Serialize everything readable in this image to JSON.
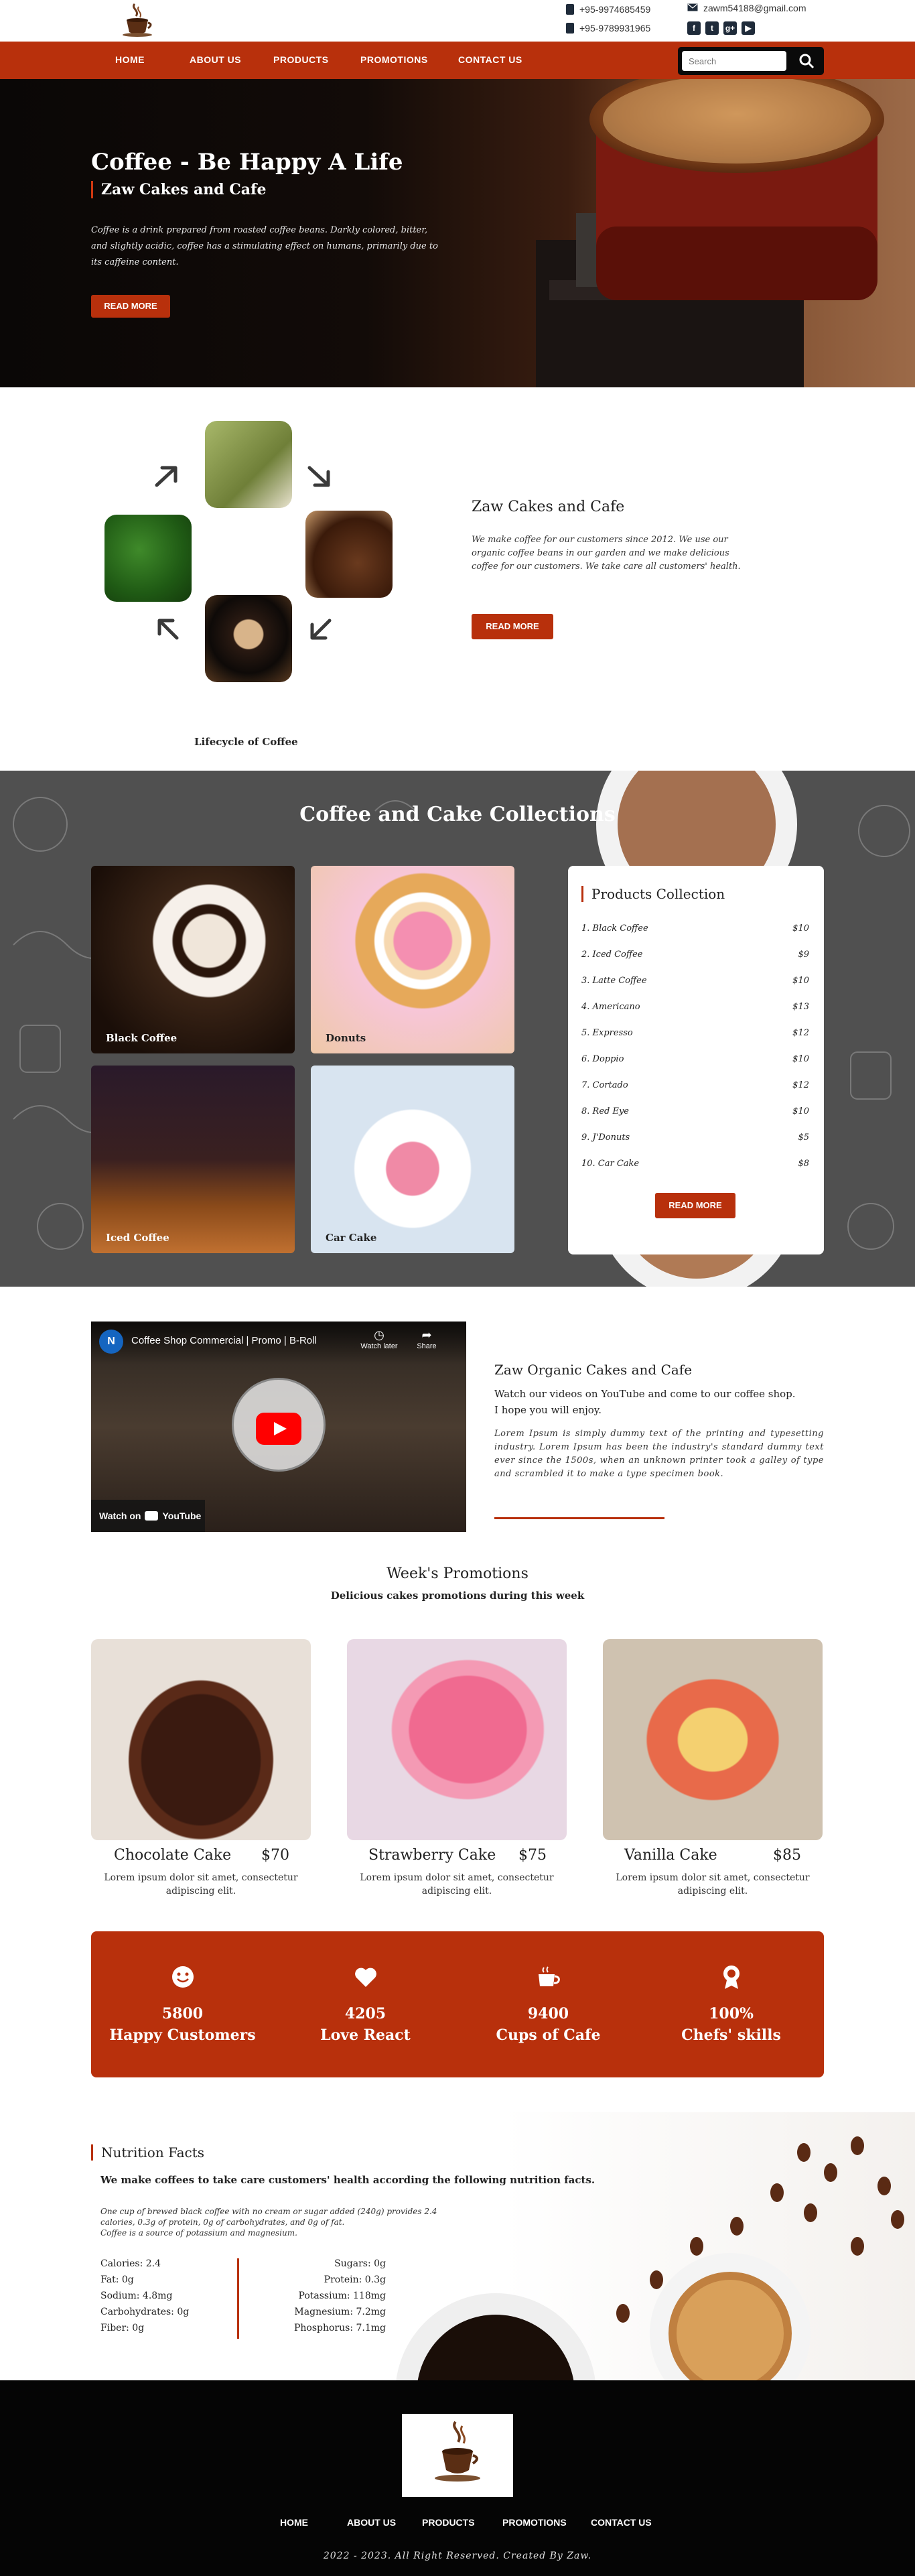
{
  "header": {
    "logo_alt": "Zaw Cakes and Cafe logo",
    "phone_1": "+95-9974685459",
    "phone_2": "+95-9789931965",
    "email": "zawm54188@gmail.com",
    "social": [
      "facebook-icon",
      "twitter-icon",
      "google-plus-icon",
      "youtube-icon"
    ]
  },
  "nav": {
    "items": [
      "HOME",
      "ABOUT US",
      "PRODUCTS",
      "PROMOTIONS",
      "CONTACT US"
    ],
    "search_placeholder": "Search"
  },
  "hero": {
    "title": "Coffee - Be Happy A Life",
    "subtitle": "Zaw Cakes and Cafe",
    "body": "Coffee is a drink prepared from roasted coffee beans. Darkly colored, bitter, and slightly acidic, coffee has a stimulating effect on humans, primarily due to its caffeine content.",
    "button": "READ MORE"
  },
  "about": {
    "title": "Zaw Cakes and Cafe",
    "body": "We make coffee for our customers since 2012. We use our organic coffee beans in our garden and we make delicious coffee for our customers. We take care all customers' health.",
    "button": "READ MORE",
    "lifecycle_caption": "Lifecycle of Coffee"
  },
  "collections": {
    "title": "Coffee and Cake Collections",
    "tiles": [
      "Black Coffee",
      "Donuts",
      "Iced Coffee",
      "Car Cake"
    ],
    "products_title": "Products Collection",
    "products": [
      {
        "name": "1. Black Coffee",
        "price": "$10"
      },
      {
        "name": "2. Iced Coffee",
        "price": "$9"
      },
      {
        "name": "3. Latte Coffee",
        "price": "$10"
      },
      {
        "name": "4. Americano",
        "price": "$13"
      },
      {
        "name": "5. Expresso",
        "price": "$12"
      },
      {
        "name": "6. Doppio",
        "price": "$10"
      },
      {
        "name": "7. Cortado",
        "price": "$12"
      },
      {
        "name": "8. Red Eye",
        "price": "$10"
      },
      {
        "name": "9. J'Donuts",
        "price": "$5"
      },
      {
        "name": "10. Car Cake",
        "price": "$8"
      }
    ],
    "button": "READ MORE"
  },
  "video": {
    "channel_letter": "N",
    "title": "Coffee Shop Commercial | Promo | B-Roll",
    "watch_later": "Watch later",
    "share": "Share",
    "watch_on": "Watch on",
    "youtube": "YouTube"
  },
  "organic": {
    "title": "Zaw Organic Cakes and Cafe",
    "lead": "Watch our videos on YouTube and come to our coffee shop. I hope you will enjoy.",
    "body": "Lorem Ipsum is simply dummy text of the printing and typesetting industry. Lorem Ipsum has been the industry's standard dummy text ever since the 1500s, when an unknown printer took a galley of type and scrambled it to make a type specimen book."
  },
  "promotions": {
    "title": "Week's Promotions",
    "subtitle": "Delicious cakes promotions during this week",
    "items": [
      {
        "name": "Chocolate Cake",
        "price": "$70",
        "desc": "Lorem ipsum dolor sit amet, consectetur adipiscing elit."
      },
      {
        "name": "Strawberry Cake",
        "price": "$75",
        "desc": "Lorem ipsum dolor sit amet, consectetur adipiscing elit."
      },
      {
        "name": "Vanilla Cake",
        "price": "$85",
        "desc": "Lorem ipsum dolor sit amet, consectetur adipiscing elit."
      }
    ]
  },
  "stats": [
    {
      "icon": "smile-icon",
      "value": "5800",
      "label": "Happy Customers"
    },
    {
      "icon": "heart-icon",
      "value": "4205",
      "label": "Love React"
    },
    {
      "icon": "coffee-cup-icon",
      "value": "9400",
      "label": "Cups of Cafe"
    },
    {
      "icon": "award-icon",
      "value": "100%",
      "label": "Chefs' skills"
    }
  ],
  "nutrition": {
    "title": "Nutrition Facts",
    "lead": "We make coffees to take care customers' health according the following nutrition facts.",
    "note_1": "One cup of brewed black coffee with no cream or sugar added (240g) provides 2.4 calories, 0.3g of protein, 0g of carbohydrates, and 0g of fat.",
    "note_2": "Coffee is a source of potassium and magnesium.",
    "left": [
      "Calories: 2.4",
      "Fat: 0g",
      "Sodium: 4.8mg",
      "Carbohydrates: 0g",
      "Fiber: 0g"
    ],
    "right": [
      "Sugars: 0g",
      "Protein: 0.3g",
      "Potassium: 118mg",
      "Magnesium: 7.2mg",
      "Phosphorus: 7.1mg"
    ]
  },
  "footer": {
    "nav": [
      "HOME",
      "ABOUT US",
      "PRODUCTS",
      "PROMOTIONS",
      "CONTACT US"
    ],
    "copyright": "2022 - 2023. All Right Reserved. Created By Zaw."
  },
  "colors": {
    "accent": "#b8300c",
    "dark": "#0a0a0a"
  }
}
